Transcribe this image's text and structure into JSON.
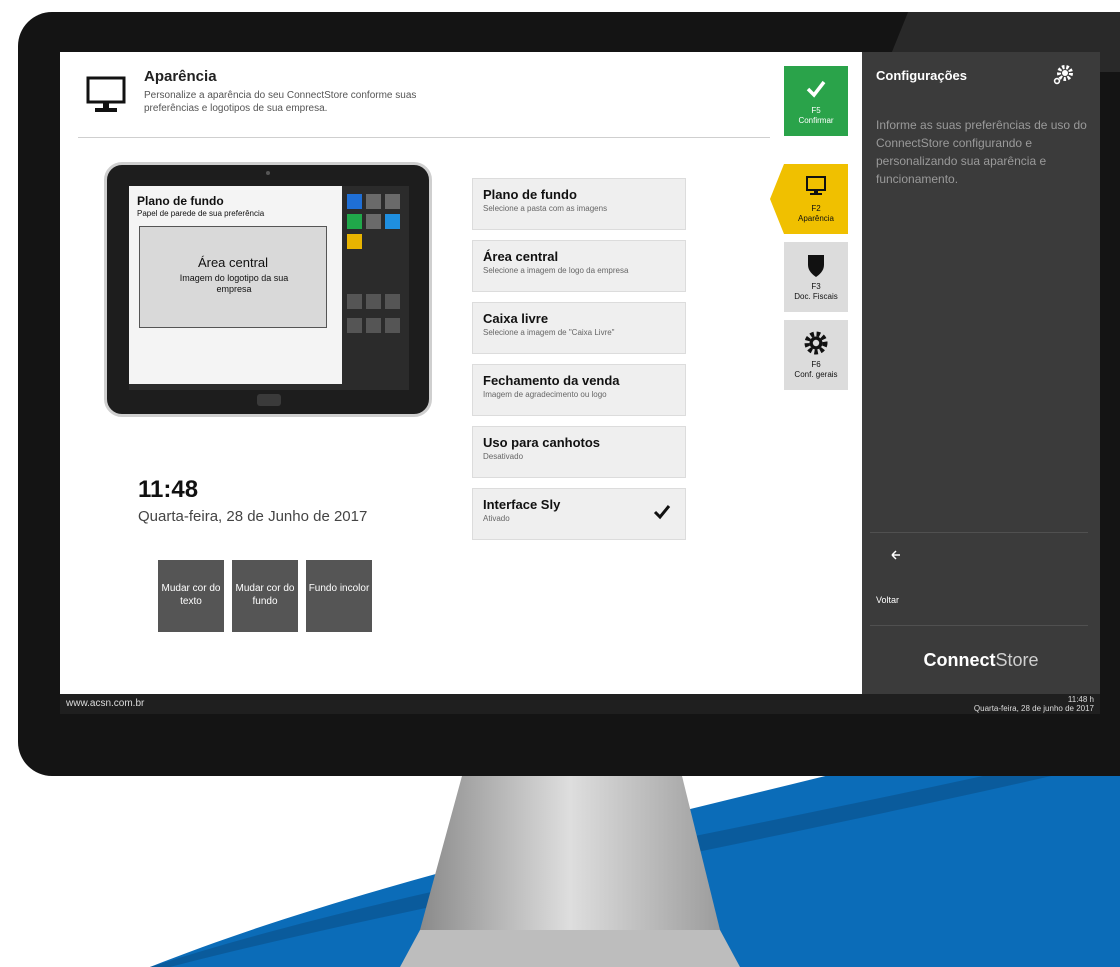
{
  "header": {
    "title": "Aparência",
    "subtitle": "Personalize a aparência do seu ConnectStore conforme suas preferências e logotipos de sua empresa."
  },
  "preview": {
    "background_title": "Plano de fundo",
    "background_sub": "Papel de parede de sua preferência",
    "central_title": "Área central",
    "central_sub": "Imagem do logotipo da sua empresa"
  },
  "clock": {
    "time": "11:48",
    "date": "Quarta-feira, 28 de Junho de 2017"
  },
  "buttons": [
    {
      "label": "Mudar cor do texto"
    },
    {
      "label": "Mudar cor do fundo"
    },
    {
      "label": "Fundo incolor"
    }
  ],
  "options": [
    {
      "title": "Plano de fundo",
      "sub": "Selecione a pasta com as imagens"
    },
    {
      "title": "Área central",
      "sub": "Selecione a imagem de logo da empresa"
    },
    {
      "title": "Caixa livre",
      "sub": "Selecione a imagem de \"Caixa Livre\""
    },
    {
      "title": "Fechamento da venda",
      "sub": "Imagem de agradecimento ou logo"
    },
    {
      "title": "Uso para canhotos",
      "sub": "Desativado"
    },
    {
      "title": "Interface Sly",
      "sub": "Ativado"
    }
  ],
  "fkeys": {
    "confirm": {
      "key": "F5",
      "label": "Confirmar"
    },
    "aparencia": {
      "key": "F2",
      "label": "Aparência"
    },
    "docs": {
      "key": "F3",
      "label": "Doc. Fiscais"
    },
    "config": {
      "key": "F6",
      "label": "Conf. gerais"
    }
  },
  "sidebar": {
    "title": "Configurações",
    "text": "Informe as suas preferências de uso do ConnectStore configurando e personalizando sua aparência e funcionamento.",
    "back_label": "Voltar",
    "brand_bold": "Connect",
    "brand_light": "Store"
  },
  "footer": {
    "url": "www.acsn.com.br",
    "time": "11:48 h",
    "date": "Quarta-feira, 28 de junho de 2017"
  },
  "colors": {
    "confirm": "#2aa34a",
    "active": "#f0c000",
    "panel": "#3b3b3b",
    "backdrop": "#0b6cb8"
  },
  "icons": [
    "monitor-icon",
    "check-icon",
    "shield-icon",
    "gear-icon",
    "back-arrow-icon",
    "settings-gear-icon"
  ]
}
